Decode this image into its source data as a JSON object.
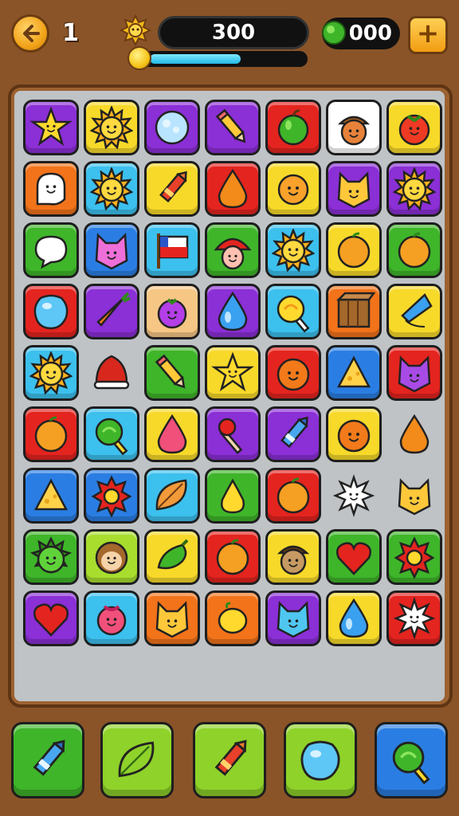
{
  "header": {
    "back_icon": "back-arrow-icon",
    "level": "1",
    "score_icon": "sun-badge-icon",
    "score": "300",
    "progress": 0.6,
    "coins": "000",
    "coin_icon": "green-gem-icon",
    "plus_label": "+"
  },
  "colors": {
    "purple": "#8b2fd6",
    "yellow": "#f7d92a",
    "red": "#e4241f",
    "orange": "#f2731a",
    "blue": "#2a7ee3",
    "sky": "#3cc0ee",
    "green": "#3fb52a",
    "lime": "#a8dd2e",
    "white": "#ffffff",
    "peach": "#f6c685"
  },
  "board": {
    "rows": [
      [
        {
          "bg": "purple",
          "icon": "star"
        },
        {
          "bg": "yellow",
          "icon": "sun"
        },
        {
          "bg": "purple",
          "icon": "cloud"
        },
        {
          "bg": "purple",
          "icon": "pencil"
        },
        {
          "bg": "red",
          "icon": "apple"
        },
        {
          "bg": "white",
          "icon": "acorn"
        },
        {
          "bg": "yellow",
          "icon": "tomato"
        }
      ],
      [
        {
          "bg": "orange",
          "icon": "ghost"
        },
        {
          "bg": "sky",
          "icon": "sun"
        },
        {
          "bg": "yellow",
          "icon": "crayon"
        },
        {
          "bg": "red",
          "icon": "drop-orange"
        },
        {
          "bg": "yellow",
          "icon": "sun-orange"
        },
        {
          "bg": "purple",
          "icon": "cat"
        },
        {
          "bg": "purple",
          "icon": "sun"
        }
      ],
      [
        {
          "bg": "green",
          "icon": "bubble"
        },
        {
          "bg": "blue",
          "icon": "cat-pink"
        },
        {
          "bg": "sky",
          "icon": "flag"
        },
        {
          "bg": "green",
          "icon": "mushroom"
        },
        {
          "bg": "sky",
          "icon": "sun"
        },
        {
          "bg": "yellow",
          "icon": "orange"
        },
        {
          "bg": "green",
          "icon": "orange"
        }
      ],
      [
        {
          "bg": "red",
          "icon": "blob-blue"
        },
        {
          "bg": "purple",
          "icon": "carrot"
        },
        {
          "bg": "peach",
          "icon": "berry-purple"
        },
        {
          "bg": "purple",
          "icon": "drop-blue"
        },
        {
          "bg": "sky",
          "icon": "lollipop"
        },
        {
          "bg": "orange",
          "icon": "box"
        },
        {
          "bg": "yellow",
          "icon": "kite"
        }
      ],
      [
        {
          "bg": "sky",
          "icon": "sun"
        },
        {
          "bg": "none",
          "icon": "cap-red"
        },
        {
          "bg": "green",
          "icon": "pencil"
        },
        {
          "bg": "yellow",
          "icon": "star"
        },
        {
          "bg": "red",
          "icon": "orange-face"
        },
        {
          "bg": "blue",
          "icon": "cheese"
        },
        {
          "bg": "red",
          "icon": "cat-purple"
        }
      ],
      [
        {
          "bg": "red",
          "icon": "orange"
        },
        {
          "bg": "sky",
          "icon": "lollipop-green"
        },
        {
          "bg": "yellow",
          "icon": "drop-pink"
        },
        {
          "bg": "purple",
          "icon": "match"
        },
        {
          "bg": "purple",
          "icon": "crayon-blue"
        },
        {
          "bg": "yellow",
          "icon": "orange-face"
        },
        {
          "bg": "none",
          "icon": "drop-orange"
        }
      ],
      [
        {
          "bg": "blue",
          "icon": "cheese"
        },
        {
          "bg": "blue",
          "icon": "flower-red"
        },
        {
          "bg": "sky",
          "icon": "leaf"
        },
        {
          "bg": "green",
          "icon": "pear"
        },
        {
          "bg": "red",
          "icon": "orange"
        },
        {
          "bg": "none",
          "icon": "sparkle"
        },
        {
          "bg": "none",
          "icon": "cat"
        }
      ],
      [
        {
          "bg": "green",
          "icon": "sun-green"
        },
        {
          "bg": "lime",
          "icon": "monkey"
        },
        {
          "bg": "yellow",
          "icon": "pepper"
        },
        {
          "bg": "red",
          "icon": "orange"
        },
        {
          "bg": "yellow",
          "icon": "acorn-brown"
        },
        {
          "bg": "green",
          "icon": "heart"
        },
        {
          "bg": "green",
          "icon": "flower-red"
        }
      ],
      [
        {
          "bg": "purple",
          "icon": "heart"
        },
        {
          "bg": "sky",
          "icon": "berry-pink"
        },
        {
          "bg": "orange",
          "icon": "cat"
        },
        {
          "bg": "orange",
          "icon": "lemon"
        },
        {
          "bg": "purple",
          "icon": "cat-blue"
        },
        {
          "bg": "yellow",
          "icon": "drop-blue"
        },
        {
          "bg": "red",
          "icon": "sparkle"
        }
      ]
    ]
  },
  "boosters": [
    {
      "bg": "#3fb52a",
      "icon": "crayon-blue"
    },
    {
      "bg": "#8fd22a",
      "icon": "leaf-green"
    },
    {
      "bg": "#8fd22a",
      "icon": "crayon"
    },
    {
      "bg": "#8fd22a",
      "icon": "blob-blue"
    },
    {
      "bg": "#2a7ee3",
      "icon": "lollipop-green"
    }
  ]
}
